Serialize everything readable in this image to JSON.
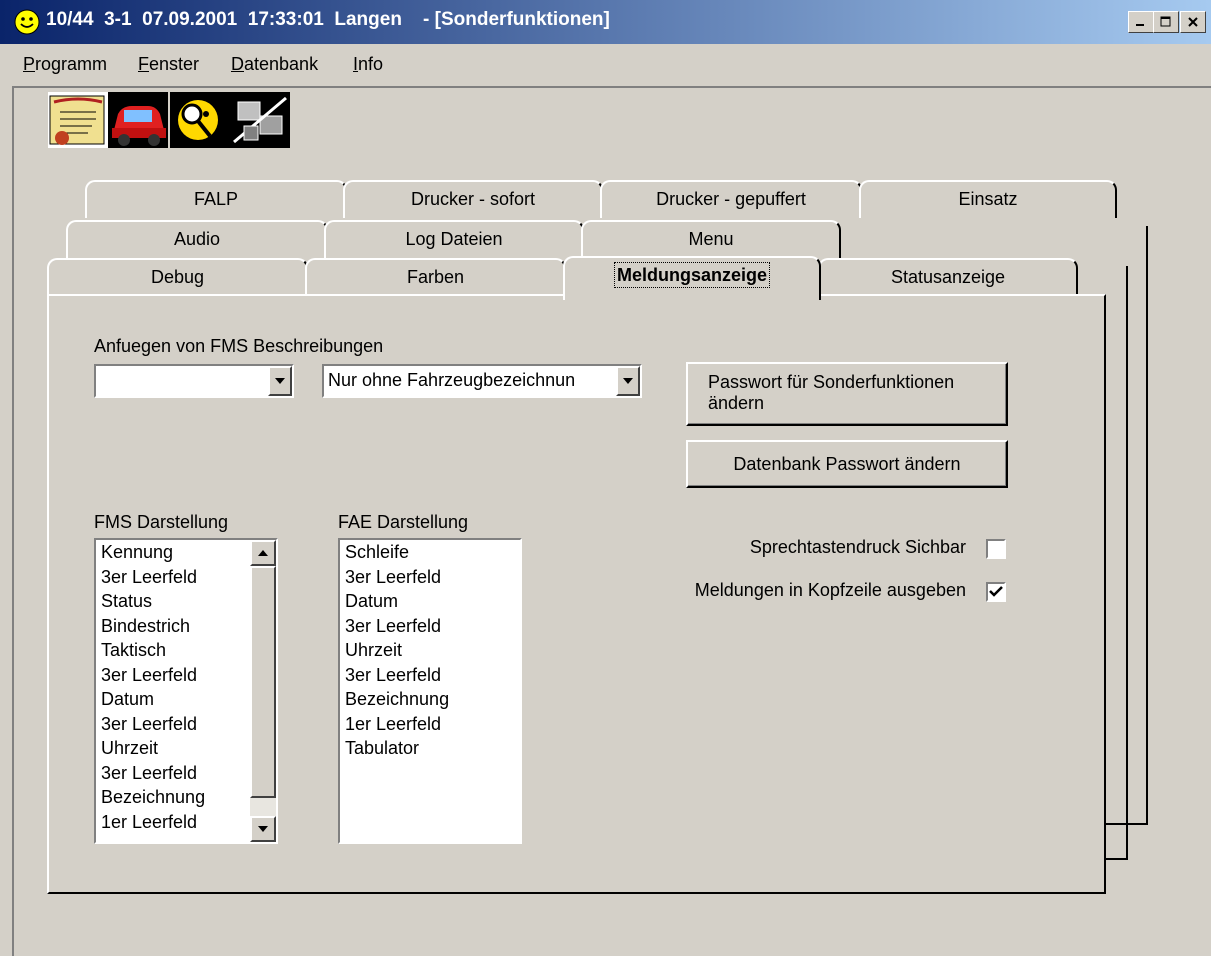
{
  "window": {
    "title": "10/44  3-1  07.09.2001  17:33:01  Langen    - [Sonderfunktionen]",
    "minimize": "_",
    "maximize": "□",
    "close": "×"
  },
  "menu": [
    {
      "label": "Programm",
      "accel": "P",
      "rest": "rogramm"
    },
    {
      "label": "Fenster",
      "accel": "F",
      "rest": "enster"
    },
    {
      "label": "Datenbank",
      "accel": "D",
      "rest": "atenbank"
    },
    {
      "label": "Info",
      "accel": "I",
      "rest": "nfo"
    }
  ],
  "toolbar": [
    "scroll-document-icon",
    "car-icon",
    "detective-magnifier-icon",
    "network-computer-icon"
  ],
  "tabs": {
    "row1": [
      "FALP",
      "Drucker - sofort",
      "Drucker - gepuffert",
      "Einsatz"
    ],
    "row2": [
      "Audio",
      "Log Dateien",
      "Menu"
    ],
    "row3": [
      "Debug",
      "Farben",
      "Meldungsanzeige",
      "Statusanzeige"
    ],
    "active": "Meldungsanzeige"
  },
  "page": {
    "fms_desc_label": "Anfuegen von FMS Beschreibungen",
    "combo1_value": "",
    "combo2_value": "Nur ohne Fahrzeugbezeichnun",
    "btn_pw_line1": "Passwort für Sonderfunktionen",
    "btn_pw_line2": "ändern",
    "btn_db_pw": "Datenbank Passwort ändern",
    "fms_label": "FMS Darstellung",
    "fae_label": "FAE Darstellung",
    "fms_list": [
      "Kennung",
      "3er Leerfeld",
      "Status",
      "Bindestrich",
      "Taktisch",
      "3er Leerfeld",
      "Datum",
      "3er Leerfeld",
      "Uhrzeit",
      "3er Leerfeld",
      "Bezeichnung",
      "1er Leerfeld"
    ],
    "fae_list": [
      "Schleife",
      "3er Leerfeld",
      "Datum",
      "3er Leerfeld",
      "Uhrzeit",
      "3er Leerfeld",
      "Bezeichnung",
      "1er Leerfeld",
      "Tabulator"
    ],
    "chk1_label": "Sprechtastendruck Sichbar",
    "chk1_checked": false,
    "chk2_label": "Meldungen in Kopfzeile ausgeben",
    "chk2_checked": true
  }
}
